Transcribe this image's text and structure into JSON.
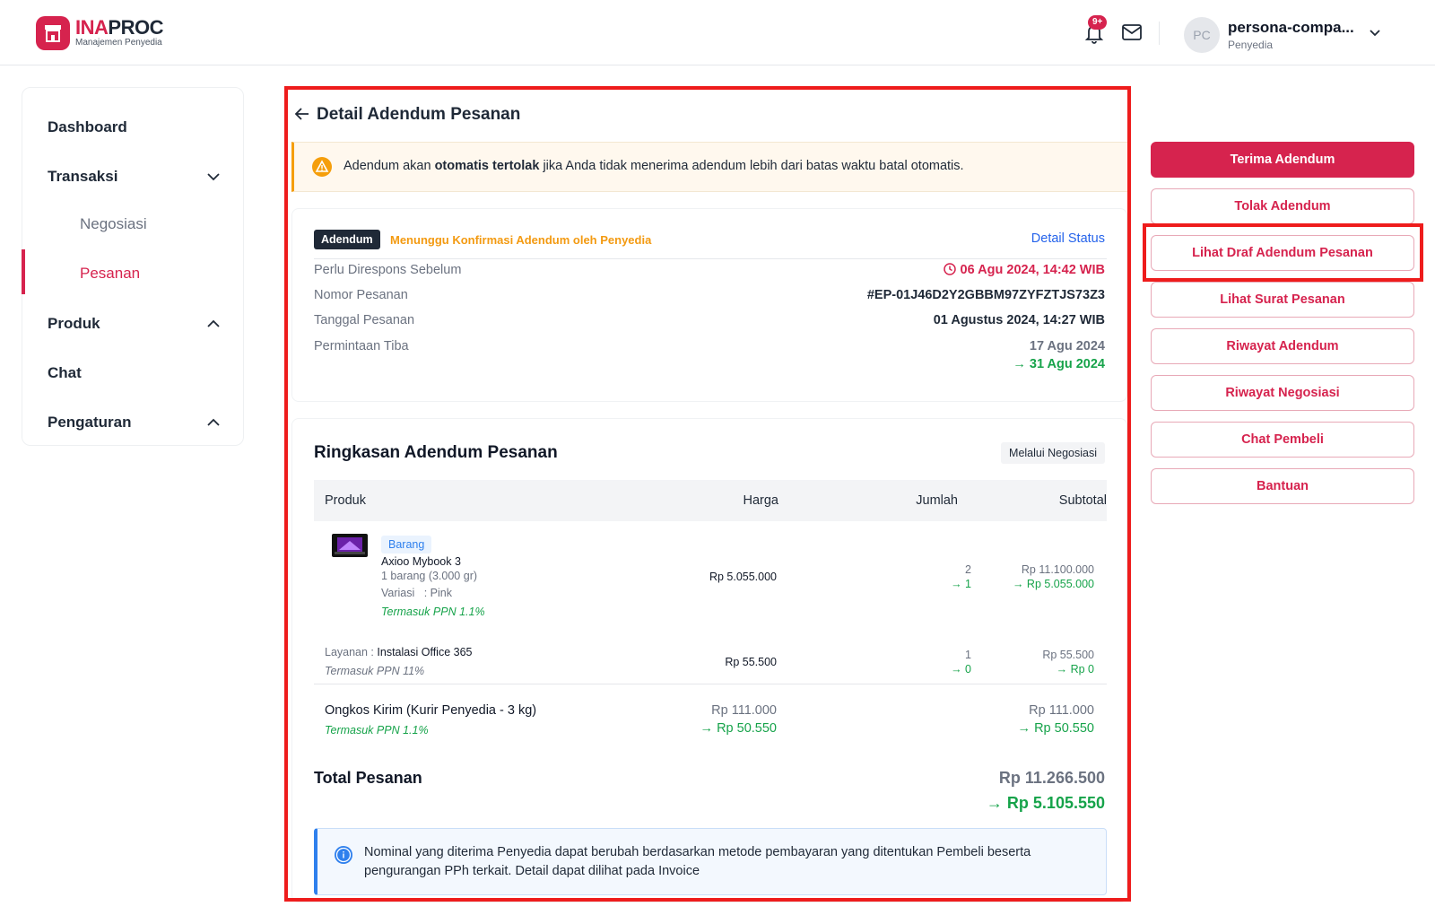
{
  "header": {
    "logo_ina": "INA",
    "logo_proc": "PROC",
    "logo_subtitle": "Manajemen Penyedia",
    "notif_badge": "9+",
    "avatar_initials": "PC",
    "user_name": "persona-compa...",
    "user_role": "Penyedia"
  },
  "sidebar": {
    "items": [
      {
        "label": "Dashboard"
      },
      {
        "label": "Transaksi"
      },
      {
        "label": "Negosiasi"
      },
      {
        "label": "Pesanan"
      },
      {
        "label": "Produk"
      },
      {
        "label": "Chat"
      },
      {
        "label": "Pengaturan"
      }
    ]
  },
  "page": {
    "title": "Detail Adendum Pesanan"
  },
  "warning": {
    "prefix": "Adendum akan ",
    "bold": "otomatis tertolak",
    "suffix": " jika Anda tidak menerima adendum lebih dari batas waktu batal otomatis."
  },
  "status": {
    "tag": "Adendum",
    "text": "Menunggu Konfirmasi Adendum oleh Penyedia",
    "detail_link": "Detail Status",
    "rows": [
      {
        "label": "Perlu Direspons Sebelum",
        "value": "06 Agu 2024, 14:42 WIB"
      },
      {
        "label": "Nomor Pesanan",
        "value": "#EP-01J46D2Y2GBBM97ZYFZTJS73Z3"
      },
      {
        "label": "Tanggal Pesanan",
        "value": "01 Agustus 2024, 14:27 WIB"
      },
      {
        "label": "Permintaan Tiba",
        "value": "17 Agu 2024",
        "value_new": "→ 31 Agu 2024"
      }
    ]
  },
  "summary": {
    "title": "Ringkasan Adendum Pesanan",
    "pill": "Melalui Negosiasi",
    "columns": [
      "Produk",
      "Harga",
      "Jumlah",
      "Subtotal"
    ],
    "product": {
      "type_tag": "Barang",
      "name": "Axioo Mybook 3",
      "detail": "1 barang (3.000 gr)",
      "variant": "Variasi   : Pink",
      "ppn": "Termasuk PPN 1.1%",
      "price": "Rp 5.055.000",
      "qty_old": "2",
      "qty_new": "→ 1",
      "subtotal_old": "Rp 11.100.000",
      "subtotal_new": "→ Rp 5.055.000"
    },
    "service": {
      "label": "Layanan : ",
      "name": "Instalasi Office 365",
      "ppn": "Termasuk PPN 11%",
      "price": "Rp 55.500",
      "qty_old": "1",
      "qty_new": "→ 0",
      "subtotal_old": "Rp 55.500",
      "subtotal_new": "→ Rp 0"
    },
    "shipping": {
      "label": "Ongkos Kirim (Kurir Penyedia - 3 kg)",
      "ppn": "Termasuk PPN 1.1%",
      "price_old": "Rp 111.000",
      "price_new": "→ Rp 50.550",
      "subtotal_old": "Rp 111.000",
      "subtotal_new": "→ Rp 50.550"
    },
    "total_label": "Total Pesanan",
    "total_old": "Rp 11.266.500",
    "total_new": "→ Rp 5.105.550",
    "info": "Nominal yang diterima Penyedia dapat berubah berdasarkan metode pembayaran yang ditentukan Pembeli beserta pengurangan PPh terkait. Detail dapat dilihat pada Invoice"
  },
  "actions": [
    {
      "label": "Terima Adendum"
    },
    {
      "label": "Tolak Adendum"
    },
    {
      "label": "Lihat Draf Adendum Pesanan"
    },
    {
      "label": "Lihat Surat Pesanan"
    },
    {
      "label": "Riwayat Adendum"
    },
    {
      "label": "Riwayat Negosiasi"
    },
    {
      "label": "Chat Pembeli"
    },
    {
      "label": "Bantuan"
    }
  ],
  "colors": {
    "brand": "#d6234e",
    "warning": "#f59e0b",
    "success": "#16a34a",
    "link": "#2563eb",
    "highlight_frame": "#ee1c1c"
  }
}
